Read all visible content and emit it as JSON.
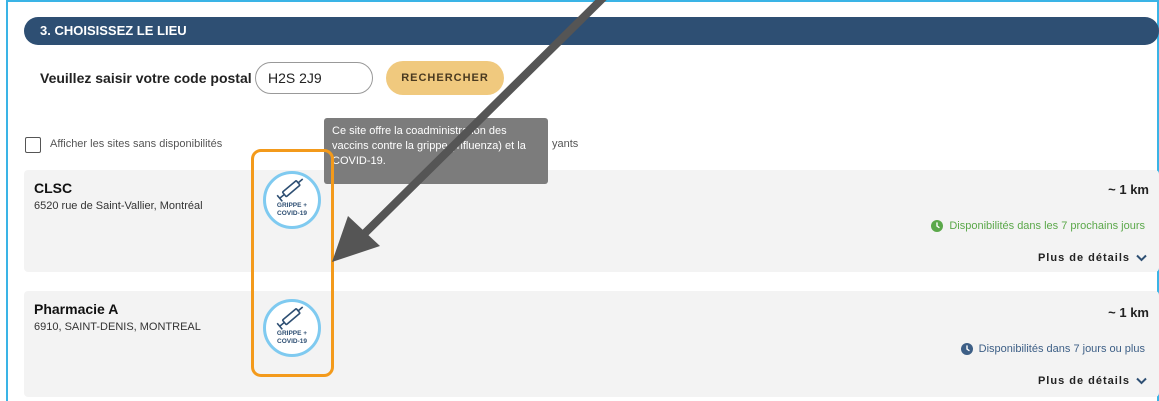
{
  "section": {
    "title": "3. CHOISISSEZ LE LIEU"
  },
  "postal": {
    "label": "Veuillez saisir votre code postal",
    "value": "H2S 2J9",
    "search_label": "RECHERCHER"
  },
  "filters": {
    "show_unavailable_label": "Afficher les sites sans disponibilités",
    "trailing_text": "yants",
    "checked": false
  },
  "tooltip": {
    "text": "Ce site offre la coadministration des vaccins contre la grippe (influenza) et la COVID-19."
  },
  "badge": {
    "line1": "GRIPPE +",
    "line2": "COVID-19",
    "icon": "syringe-icon"
  },
  "sites": [
    {
      "name": "CLSC",
      "address": "6520 rue de Saint-Vallier, Montréal",
      "distance": "~ 1 km",
      "availability": "Disponibilités dans les 7 prochains jours",
      "availability_color": "#5ba84a",
      "details_label": "Plus de détails"
    },
    {
      "name": "Pharmacie A",
      "address": "6910, SAINT-DENIS, MONTREAL",
      "distance": "~ 1 km",
      "availability": "Disponibilités dans 7 jours ou plus",
      "availability_color": "#3d5f86",
      "details_label": "Plus de détails"
    }
  ],
  "colors": {
    "header": "#2e4f73",
    "button": "#f0c97e",
    "highlight": "#f39a1b",
    "badge_ring": "#7fcaf0"
  }
}
